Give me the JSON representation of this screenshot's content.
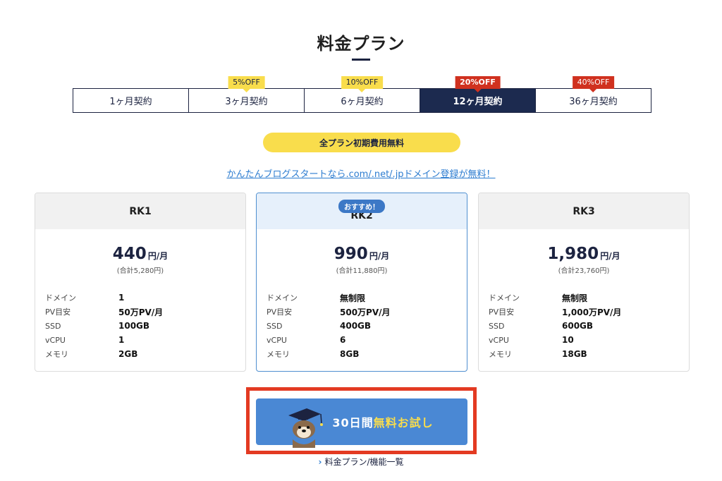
{
  "header": {
    "title": "料金プラン"
  },
  "tabs": [
    {
      "label": "1ヶ月契約",
      "badge": ""
    },
    {
      "label": "3ヶ月契約",
      "badge": "5%OFF"
    },
    {
      "label": "6ヶ月契約",
      "badge": "10%OFF"
    },
    {
      "label": "12ヶ月契約",
      "badge": "20%OFF",
      "active": true
    },
    {
      "label": "36ヶ月契約",
      "badge": "40%OFF"
    }
  ],
  "banner": {
    "text": "全プラン初期費用無料"
  },
  "promo_link": {
    "text": "かんたんブログスタートなら.com/.net/.jpドメイン登録が無料！"
  },
  "plans": [
    {
      "name": "RK1",
      "price": "440",
      "price_unit": "円/月",
      "total": "(合計5,280円)",
      "specs": [
        {
          "key": "ドメイン",
          "value": "1"
        },
        {
          "key": "PV目安",
          "value": "50万PV/月"
        },
        {
          "key": "SSD",
          "value": "100GB"
        },
        {
          "key": "vCPU",
          "value": "1"
        },
        {
          "key": "メモリ",
          "value": "2GB"
        }
      ]
    },
    {
      "name": "RK2",
      "recommended": "おすすめ！",
      "price": "990",
      "price_unit": "円/月",
      "total": "(合計11,880円)",
      "specs": [
        {
          "key": "ドメイン",
          "value": "無制限"
        },
        {
          "key": "PV目安",
          "value": "500万PV/月"
        },
        {
          "key": "SSD",
          "value": "400GB"
        },
        {
          "key": "vCPU",
          "value": "6"
        },
        {
          "key": "メモリ",
          "value": "8GB"
        }
      ]
    },
    {
      "name": "RK3",
      "price": "1,980",
      "price_unit": "円/月",
      "total": "(合計23,760円)",
      "specs": [
        {
          "key": "ドメイン",
          "value": "無制限"
        },
        {
          "key": "PV目安",
          "value": "1,000万PV/月"
        },
        {
          "key": "SSD",
          "value": "600GB"
        },
        {
          "key": "vCPU",
          "value": "10"
        },
        {
          "key": "メモリ",
          "value": "18GB"
        }
      ]
    }
  ],
  "cta": {
    "prefix": "30日間",
    "highlight": "無料お試し"
  },
  "more_link": {
    "arrow": "›",
    "text": "料金プラン/機能一覧"
  },
  "colors": {
    "navy": "#1c2a4f",
    "yellow": "#f9dd4c",
    "red": "#d0311f",
    "blue": "#4a88d4",
    "highlight_frame": "#e33a22"
  }
}
